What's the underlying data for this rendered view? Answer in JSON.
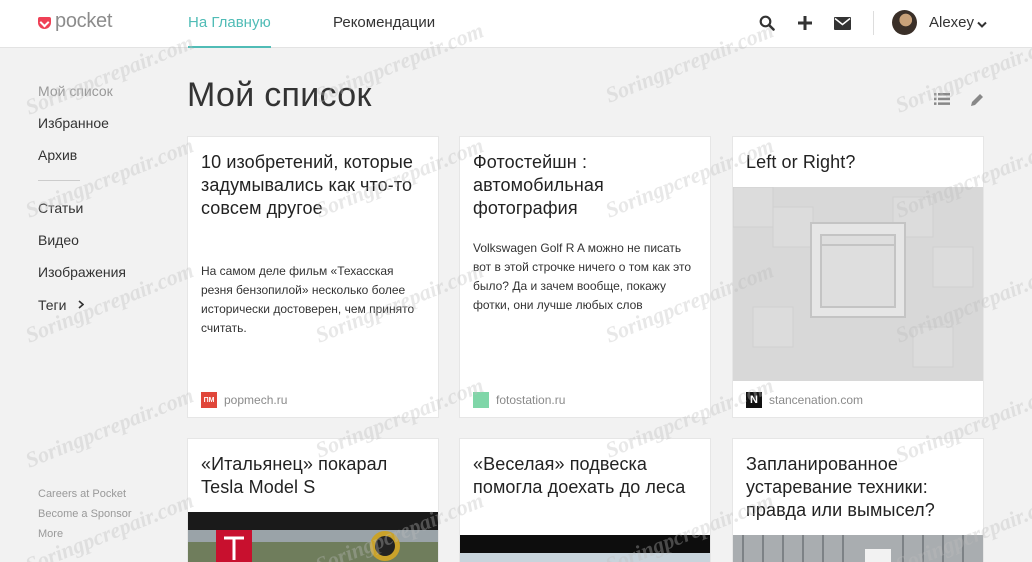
{
  "header": {
    "logo_text": "pocket",
    "tabs": [
      {
        "label": "На Главную",
        "active": true
      },
      {
        "label": "Рекомендации",
        "active": false
      }
    ],
    "icons": [
      "search-icon",
      "plus-icon",
      "mail-icon"
    ],
    "user_name": "Alexey"
  },
  "sidebar": {
    "items": [
      {
        "label": "Мой список",
        "selected": true
      },
      {
        "label": "Избранное"
      },
      {
        "label": "Архив"
      },
      {
        "label": "Статьи"
      },
      {
        "label": "Видео"
      },
      {
        "label": "Изображения"
      },
      {
        "label": "Теги"
      }
    ],
    "footer": [
      "Careers at Pocket",
      "Become a Sponsor",
      "More"
    ]
  },
  "main": {
    "title": "Мой список",
    "view_icons": [
      "list-view-icon",
      "edit-icon"
    ]
  },
  "cards": [
    {
      "title": "10 изобретений, которые задумывались как что-то совсем другое",
      "excerpt": "На самом деле фильм «Техасская резня бензопилой» несколько более исторически достоверен, чем принято считать.",
      "source": "popmech.ru",
      "favicon_text": "ПМ",
      "favicon_color": "#e0463a"
    },
    {
      "title": "Фотостейшн : автомобильная фотография",
      "excerpt": "Volkswagen Golf R A можно не писать вот в этой строчке ничего о том как это было? Да и зачем вообще, покажу фотки, они лучше любых слов",
      "source": "fotostation.ru",
      "favicon_color": "#7fd6a8"
    },
    {
      "title": "Left or Right?",
      "source": "stancenation.com",
      "favicon_text": "N",
      "favicon_color": "#111111"
    },
    {
      "title": "«Итальянец» покарал Tesla Model S"
    },
    {
      "title": "«Веселая» подвеска помогла доехать до леса"
    },
    {
      "title": "Запланированное устаревание техники: правда или вымысел?"
    }
  ],
  "colors": {
    "accent": "#50bcb6",
    "brand": "#ef4056"
  },
  "watermark_text": "Soringpcrepair.com"
}
